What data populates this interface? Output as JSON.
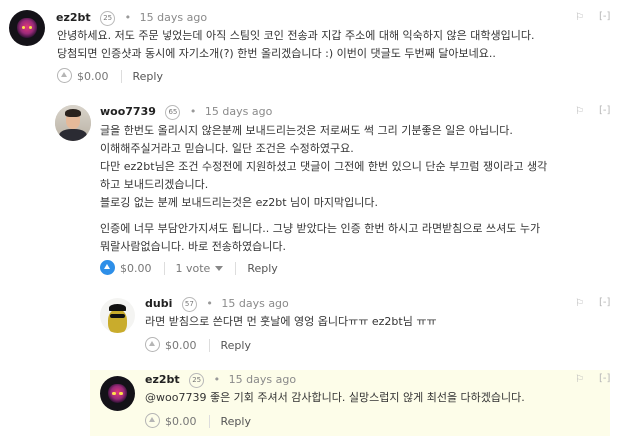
{
  "comments": [
    {
      "author": "ez2bt",
      "reputation": "25",
      "time": "15 days ago",
      "controls": [
        "[-]"
      ],
      "lines": [
        "안녕하세요. 저도 주문 넣었는데 아직 스팀잇 코인 전송과 지갑 주소에 대해 익숙하지 않은 대학생입니다.",
        "당첨되면 인증샷과 동시에 자기소개(?) 한번 올리겠습니다 :) 이번이 댓글도 두번째 달아보네요.."
      ],
      "amount": "$0.00",
      "reply": "Reply"
    },
    {
      "author": "woo7739",
      "reputation": "65",
      "time": "15 days ago",
      "controls": [
        "[-]"
      ],
      "lines": [
        "글을 한번도 올리시지 않은분께 보내드리는것은 저로써도 썩 그리 기분좋은 일은 아닙니다.",
        "이해해주실거라고 믿습니다. 일단 조건은 수정하였구요.",
        "다만 ez2bt님은 조건 수정전에 지원하셨고 댓글이 그전에 한번 있으니 단순 부끄럼 쟁이라고 생각",
        "하고 보내드리겠습니다.",
        "블로깅 없는 분께 보내드리는것은 ez2bt 님이 마지막입니다.",
        "인증에 너무 부담안가지셔도 됩니다.. 그냥 받았다는 인증 한번 하시고 라면받침으로 쓰셔도 누가",
        "뭐랄사람없습니다. 바로 전송하였습니다."
      ],
      "amount": "$0.00",
      "votes": "1 vote",
      "reply": "Reply"
    },
    {
      "author": "dubi",
      "reputation": "57",
      "time": "15 days ago",
      "controls": [
        "[-]"
      ],
      "lines": [
        "라면 받침으로 쓴다면 먼 훗날에 영엉 옵니다ㅠㅠ ez2bt님 ㅠㅠ"
      ],
      "amount": "$0.00",
      "reply": "Reply"
    },
    {
      "author": "ez2bt",
      "reputation": "25",
      "time": "15 days ago",
      "controls": [
        "[-]"
      ],
      "lines": [
        "@woo7739 좋은 기회 주셔서 감사합니다. 실망스럽지 않게 최선을 다하겠습니다."
      ],
      "amount": "$0.00",
      "reply": "Reply"
    }
  ],
  "colors": {
    "highlight_bg": "#fdfde9",
    "upvote_active": "#2e8fe8"
  }
}
